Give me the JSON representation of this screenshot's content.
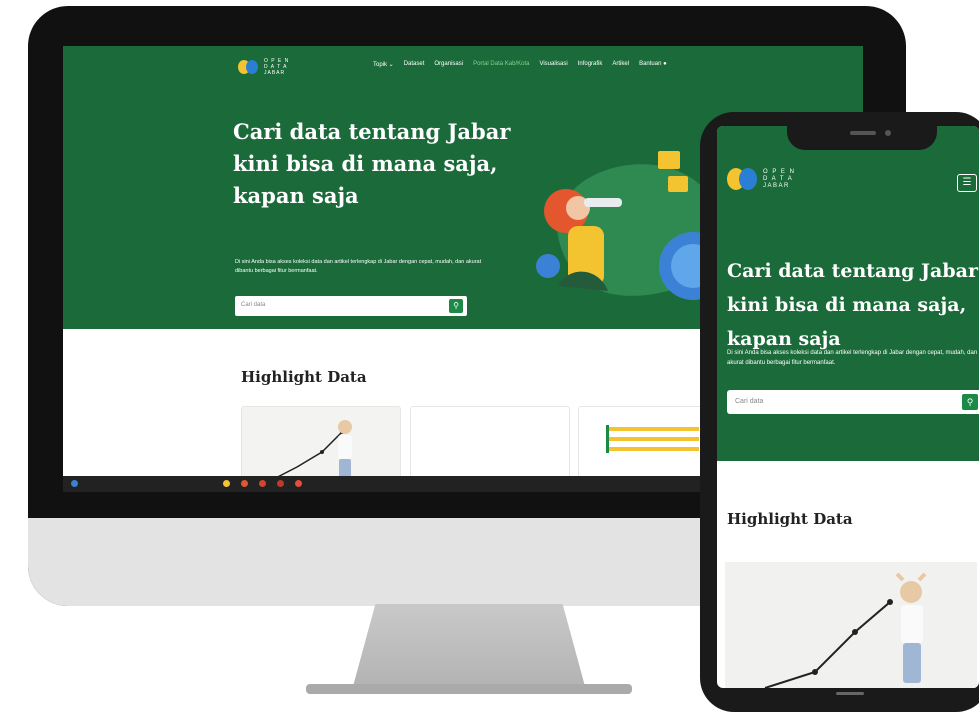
{
  "colors": {
    "brand_green": "#1b6b3a",
    "accent_green": "#1b8a47",
    "nav_active": "#7fd38f",
    "logo_yellow": "#f4c430",
    "logo_blue": "#2a7fd4",
    "chart_yellow": "#f4c430"
  },
  "logo": {
    "text": "O P E N\nD A T A\nJABAR"
  },
  "desktop": {
    "nav": [
      {
        "label": "Topik ⌄",
        "active": false
      },
      {
        "label": "Dataset",
        "active": false
      },
      {
        "label": "Organisasi",
        "active": false
      },
      {
        "label": "Portal Data Kab/Kota",
        "active": true
      },
      {
        "label": "Visualisasi",
        "active": false
      },
      {
        "label": "Infografik",
        "active": false
      },
      {
        "label": "Artikel",
        "active": false
      },
      {
        "label": "Bantuan ●",
        "active": false
      }
    ],
    "hero": {
      "title": "Cari data tentang Jabar kini bisa di mana saja, kapan saja",
      "subtitle": "Di sini Anda bisa akses koleksi data dan artikel terlengkap di Jabar dengan cepat, mudah, dan akurat dibantu berbagai fitur bermanfaat.",
      "search_placeholder": "Cari data",
      "search_icon": "search-icon"
    },
    "highlight": {
      "title": "Highlight Data",
      "cards": [
        {
          "kind": "photo"
        },
        {
          "kind": "blank"
        },
        {
          "kind": "bar-chart"
        }
      ]
    }
  },
  "phone": {
    "menu_icon": "hamburger-menu-icon",
    "hero": {
      "title": "Cari data tentang Jabar kini bisa di mana saja, kapan saja",
      "subtitle": "Di sini Anda bisa akses koleksi data dan artikel terlengkap di Jabar dengan cepat, mudah, dan akurat dibantu berbagai fitur bermanfaat.",
      "search_placeholder": "Cari data",
      "search_icon": "search-icon"
    },
    "highlight": {
      "title": "Highlight Data"
    }
  }
}
